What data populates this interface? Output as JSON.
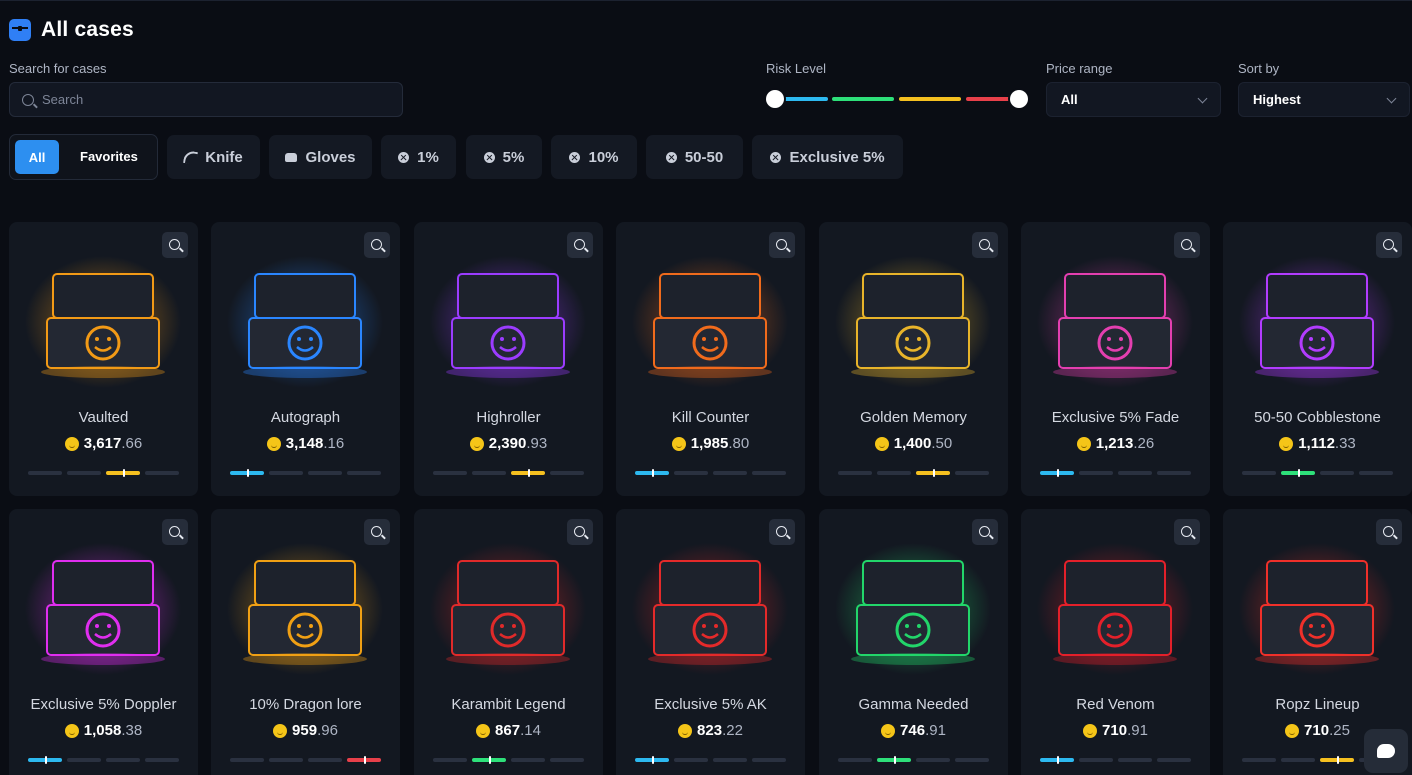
{
  "header": {
    "title": "All cases",
    "icon": "case-icon"
  },
  "search": {
    "label": "Search for cases",
    "placeholder": "Search"
  },
  "risk": {
    "label": "Risk Level",
    "colors": [
      "#2db9f0",
      "#2ee07a",
      "#f5c020",
      "#e8404a"
    ]
  },
  "price_range": {
    "label": "Price range",
    "value": "All"
  },
  "sort": {
    "label": "Sort by",
    "value": "Highest"
  },
  "tabs": {
    "all": "All",
    "favorites": "Favorites"
  },
  "chips": [
    {
      "label": "Knife",
      "icon": "knife-icon"
    },
    {
      "label": "Gloves",
      "icon": "gloves-icon"
    },
    {
      "label": "1%",
      "icon": "x-icon"
    },
    {
      "label": "5%",
      "icon": "x-icon"
    },
    {
      "label": "10%",
      "icon": "x-icon"
    },
    {
      "label": "50-50",
      "icon": "x-icon"
    },
    {
      "label": "Exclusive 5%",
      "icon": "x-icon"
    }
  ],
  "cases": [
    {
      "name": "Vaulted",
      "price_int": "3,617",
      "price_cents": ".66",
      "risk": 3,
      "glow": "#f29a16"
    },
    {
      "name": "Autograph",
      "price_int": "3,148",
      "price_cents": ".16",
      "risk": 1,
      "glow": "#2a86ff"
    },
    {
      "name": "Highroller",
      "price_int": "2,390",
      "price_cents": ".93",
      "risk": 3,
      "glow": "#9b3cff"
    },
    {
      "name": "Kill Counter",
      "price_int": "1,985",
      "price_cents": ".80",
      "risk": 1,
      "glow": "#f06b1c"
    },
    {
      "name": "Golden Memory",
      "price_int": "1,400",
      "price_cents": ".50",
      "risk": 3,
      "glow": "#e8b42a"
    },
    {
      "name": "Exclusive 5% Fade",
      "price_int": "1,213",
      "price_cents": ".26",
      "risk": 1,
      "glow": "#e43fb0"
    },
    {
      "name": "50-50 Cobblestone",
      "price_int": "1,112",
      "price_cents": ".33",
      "risk": 2,
      "glow": "#b23cff"
    },
    {
      "name": "Exclusive 5% Doppler",
      "price_int": "1,058",
      "price_cents": ".38",
      "risk": 1,
      "glow": "#e02ef0"
    },
    {
      "name": "10% Dragon lore",
      "price_int": "959",
      "price_cents": ".96",
      "risk": 4,
      "glow": "#f0a014"
    },
    {
      "name": "Karambit Legend",
      "price_int": "867",
      "price_cents": ".14",
      "risk": 2,
      "glow": "#e02a2a"
    },
    {
      "name": "Exclusive 5% AK",
      "price_int": "823",
      "price_cents": ".22",
      "risk": 1,
      "glow": "#e42a2a"
    },
    {
      "name": "Gamma Needed",
      "price_int": "746",
      "price_cents": ".91",
      "risk": 2,
      "glow": "#22d66a"
    },
    {
      "name": "Red Venom",
      "price_int": "710",
      "price_cents": ".91",
      "risk": 1,
      "glow": "#e4202a"
    },
    {
      "name": "Ropz Lineup",
      "price_int": "710",
      "price_cents": ".25",
      "risk": 3,
      "glow": "#f0302a"
    }
  ]
}
